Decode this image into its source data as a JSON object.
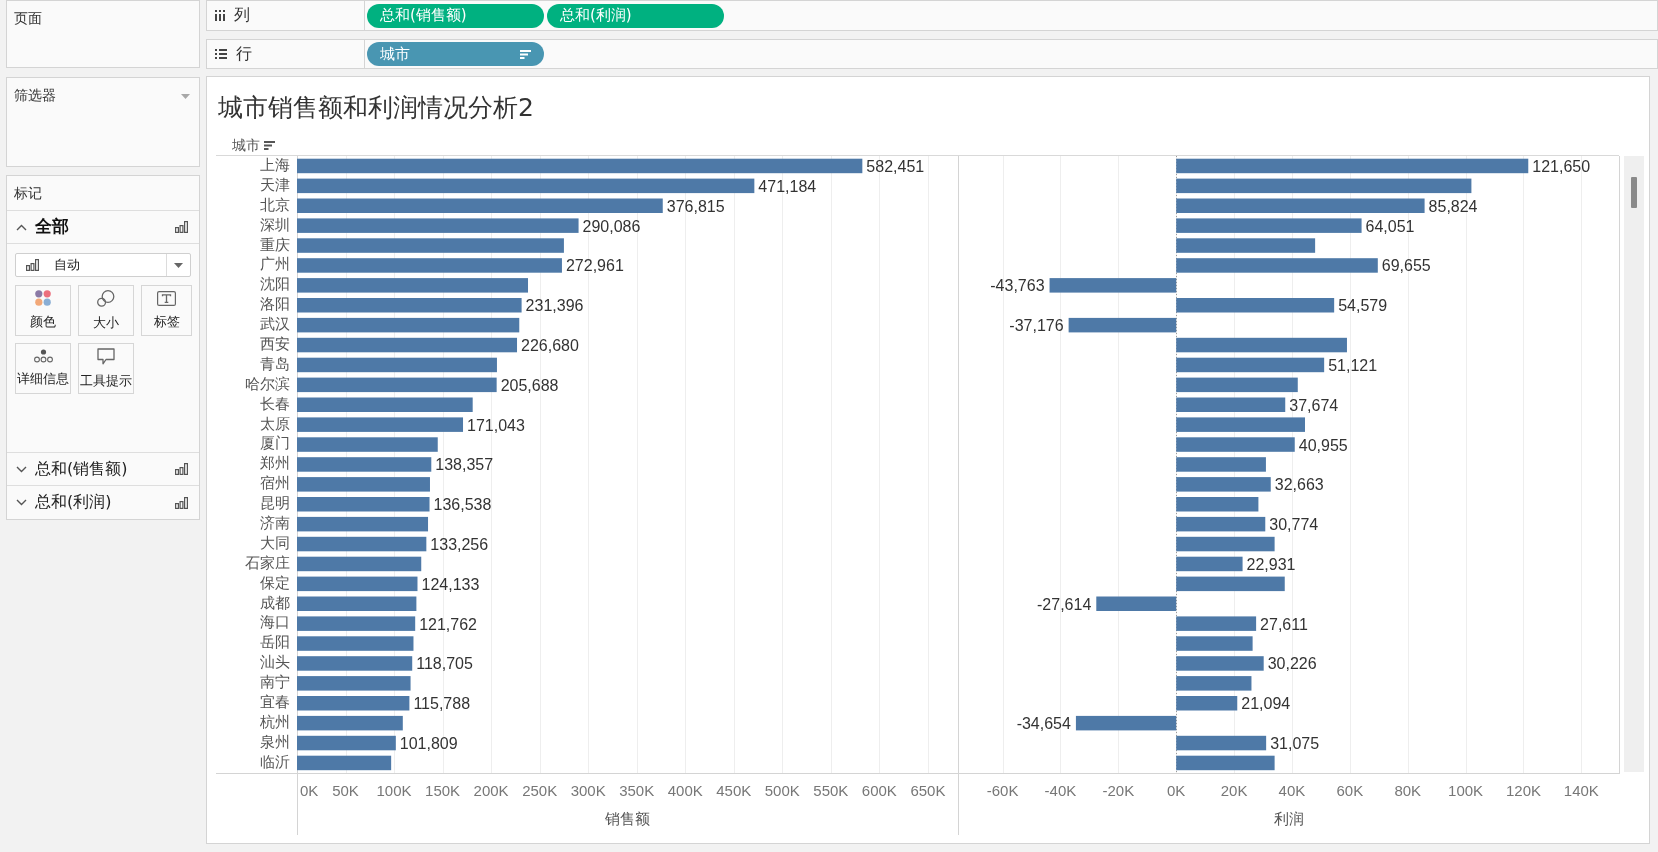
{
  "shelves": [
    {
      "kind": "columns",
      "label": "列",
      "pills": [
        {
          "label": "总和(销售额)",
          "kind": "continuous",
          "sorted": false
        },
        {
          "label": "总和(利润)",
          "kind": "continuous",
          "sorted": false
        }
      ]
    },
    {
      "kind": "rows",
      "label": "行",
      "pills": [
        {
          "label": "城市",
          "kind": "discrete",
          "sorted": true
        }
      ]
    }
  ],
  "side_panel": {
    "cards": [
      {
        "kind": "pages",
        "title": "页面"
      },
      {
        "kind": "filters",
        "title": "筛选器"
      },
      {
        "kind": "marks",
        "title": "标记",
        "cards": [
          {
            "label": "全部",
            "kind": "all",
            "expanded": true,
            "mark_type": "自动",
            "buttons": [
              {
                "label": "颜色",
                "kind": "color"
              },
              {
                "label": "大小",
                "kind": "size"
              },
              {
                "label": "标签",
                "kind": "label"
              },
              {
                "label": "详细信息",
                "kind": "detail"
              },
              {
                "label": "工具提示",
                "kind": "tooltip"
              }
            ]
          },
          {
            "label": "总和(销售额)",
            "kind": "measure",
            "expanded": false
          },
          {
            "label": "总和(利润)",
            "kind": "measure",
            "expanded": false
          }
        ]
      }
    ]
  },
  "view": {
    "title": "城市销售额和利润情况分析2",
    "row_header": {
      "label": "城市",
      "sorted": true
    },
    "panes": [
      {
        "chart_data": {
          "type": "bar",
          "orientation": "horizontal",
          "grid": true,
          "xlabel": "销售额",
          "categories": [
            "上海",
            "天津",
            "北京",
            "深圳",
            "重庆",
            "广州",
            "沈阳",
            "洛阳",
            "武汉",
            "西安",
            "青岛",
            "哈尔滨",
            "长春",
            "太原",
            "厦门",
            "郑州",
            "宿州",
            "昆明",
            "济南",
            "大同",
            "石家庄",
            "保定",
            "成都",
            "海口",
            "岳阳",
            "汕头",
            "南宁",
            "宜春",
            "杭州",
            "泉州",
            "临沂"
          ],
          "values": [
            582451,
            471184,
            376815,
            290086,
            275000,
            272961,
            238000,
            231396,
            229000,
            226680,
            206000,
            205688,
            181000,
            171043,
            145000,
            138357,
            137000,
            136538,
            135000,
            133256,
            128000,
            124133,
            123000,
            121762,
            120000,
            118705,
            117000,
            115788,
            109000,
            101809,
            97000
          ],
          "xlim": [
            0,
            681000
          ],
          "xticks": [
            {
              "value": 0,
              "label": "0K"
            },
            {
              "value": 50000,
              "label": "50K"
            },
            {
              "value": 100000,
              "label": "100K"
            },
            {
              "value": 150000,
              "label": "150K"
            },
            {
              "value": 200000,
              "label": "200K"
            },
            {
              "value": 250000,
              "label": "250K"
            },
            {
              "value": 300000,
              "label": "300K"
            },
            {
              "value": 350000,
              "label": "350K"
            },
            {
              "value": 400000,
              "label": "400K"
            },
            {
              "value": 450000,
              "label": "450K"
            },
            {
              "value": 500000,
              "label": "500K"
            },
            {
              "value": 550000,
              "label": "550K"
            },
            {
              "value": 600000,
              "label": "600K"
            },
            {
              "value": 650000,
              "label": "650K"
            }
          ],
          "value_labels": [
            "582,451",
            "471,184",
            "376,815",
            "290,086",
            null,
            "272,961",
            null,
            "231,396",
            null,
            "226,680",
            null,
            "205,688",
            null,
            "171,043",
            null,
            "138,357",
            null,
            "136,538",
            null,
            "133,256",
            null,
            "124,133",
            null,
            "121,762",
            null,
            "118,705",
            null,
            "115,788",
            null,
            "101,809",
            null
          ]
        }
      },
      {
        "chart_data": {
          "type": "bar",
          "orientation": "horizontal",
          "grid": true,
          "xlabel": "利润",
          "values": [
            121650,
            102000,
            85824,
            64051,
            48000,
            69655,
            -43763,
            54579,
            -37176,
            59000,
            51121,
            42000,
            37674,
            44500,
            40955,
            31000,
            32663,
            28400,
            30774,
            34000,
            22931,
            37500,
            -27614,
            27611,
            26400,
            30226,
            26000,
            21094,
            -34654,
            31075,
            34000
          ],
          "xlim": [
            -75400,
            153000
          ],
          "xticks": [
            {
              "value": -60000,
              "label": "-60K"
            },
            {
              "value": -40000,
              "label": "-40K"
            },
            {
              "value": -20000,
              "label": "-20K"
            },
            {
              "value": 0,
              "label": "0K"
            },
            {
              "value": 20000,
              "label": "20K"
            },
            {
              "value": 40000,
              "label": "40K"
            },
            {
              "value": 60000,
              "label": "60K"
            },
            {
              "value": 80000,
              "label": "80K"
            },
            {
              "value": 100000,
              "label": "100K"
            },
            {
              "value": 120000,
              "label": "120K"
            },
            {
              "value": 140000,
              "label": "140K"
            }
          ],
          "ref_lines": [
            {
              "axis": "x",
              "value": 0
            }
          ],
          "value_labels": [
            "121,650",
            null,
            "85,824",
            "64,051",
            null,
            "69,655",
            "-43,763",
            "54,579",
            "-37,176",
            null,
            "51,121",
            null,
            "37,674",
            null,
            "40,955",
            null,
            "32,663",
            null,
            "30,774",
            null,
            "22,931",
            null,
            "-27,614",
            "27,611",
            null,
            "30,226",
            null,
            "21,094",
            "-34,654",
            "31,075",
            null
          ]
        }
      }
    ]
  }
}
